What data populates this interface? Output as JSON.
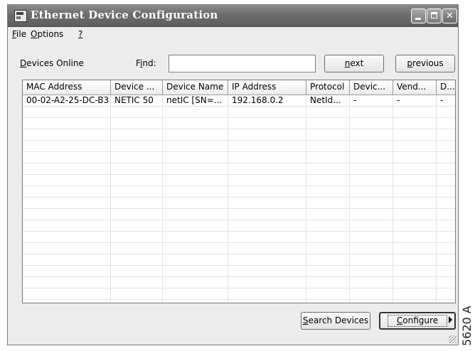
{
  "window": {
    "title": "Ethernet Device Configuration"
  },
  "title_buttons": {
    "minimize": "",
    "maximize": "",
    "close": "✕"
  },
  "menu": {
    "file": {
      "accel": "F",
      "rest": "ile"
    },
    "options": {
      "accel": "O",
      "rest": "ptions"
    },
    "help": {
      "accel": "?",
      "rest": ""
    }
  },
  "toolbar": {
    "devices_online": {
      "accel": "D",
      "rest": "evices Online"
    },
    "find_label": {
      "pre": "F",
      "accel": "i",
      "rest": "nd:"
    },
    "find_value": "",
    "next": {
      "accel": "n",
      "rest": "ext"
    },
    "previous": {
      "accel": "p",
      "rest": "revious"
    }
  },
  "table": {
    "columns": [
      "MAC Address",
      "Device ...",
      "Device Name",
      "IP Address",
      "Protocol",
      "Devic...",
      "Vend...",
      "D..."
    ],
    "rows": [
      [
        "00-02-A2-25-DC-B3",
        "NETIC 50",
        "netIC [SN=...",
        "192.168.0.2",
        "NetId...",
        "-",
        "-",
        "-"
      ]
    ]
  },
  "actions": {
    "search": {
      "accel": "S",
      "rest": "earch Devices"
    },
    "configure": {
      "accel": "C",
      "rest": "onfigure"
    }
  },
  "side_code": "5620 A"
}
